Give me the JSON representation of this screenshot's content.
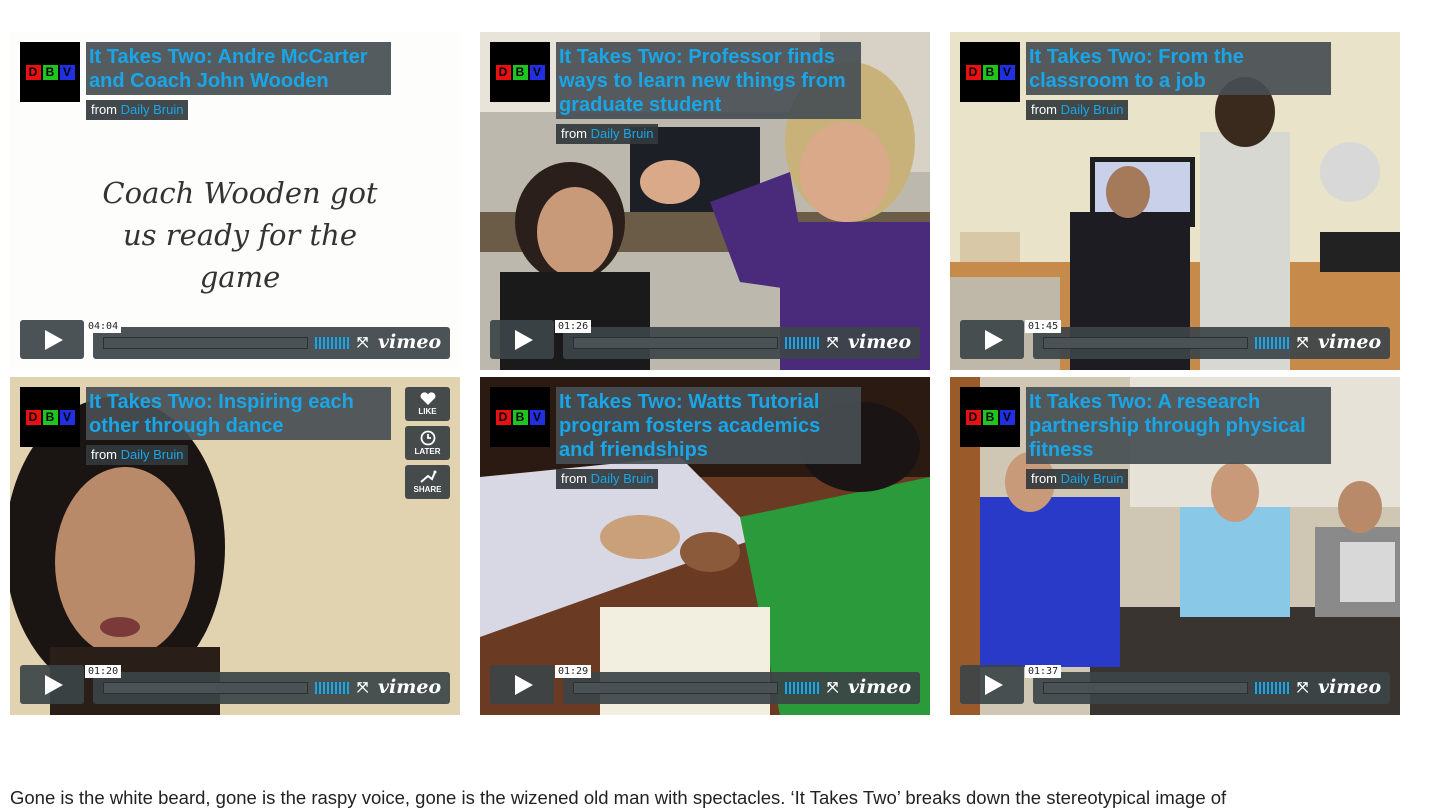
{
  "videos": [
    {
      "title": "It Takes Two: Andre McCarter and Coach John Wooden",
      "from": "from",
      "author": "Daily Bruin",
      "duration": "04:04",
      "card_text": "Coach Wooden got us ready for the game"
    },
    {
      "title": "It Takes Two: Professor finds ways to learn new things from graduate student",
      "from": "from",
      "author": "Daily Bruin",
      "duration": "01:26"
    },
    {
      "title": "It Takes Two: From the classroom to a job",
      "from": "from",
      "author": "Daily Bruin",
      "duration": "01:45"
    },
    {
      "title": "It Takes Two: Inspiring each other through dance",
      "from": "from",
      "author": "Daily Bruin",
      "duration": "01:20",
      "actions": [
        "LIKE",
        "LATER",
        "SHARE"
      ]
    },
    {
      "title": "It Takes Two: Watts Tutorial program fosters academics and friendships",
      "from": "from",
      "author": "Daily Bruin",
      "duration": "01:29"
    },
    {
      "title": "It Takes Two: A research partnership through physical fitness",
      "from": "from",
      "author": "Daily Bruin",
      "duration": "01:37"
    }
  ],
  "logo_letters": [
    "D",
    "B",
    "V"
  ],
  "vimeo_label": "vimeo",
  "article": {
    "text": "Gone is the white beard, gone is the raspy voice, gone is the wizened old man with spectacles. ‘It Takes Two’ breaks down the stereotypical image of"
  }
}
